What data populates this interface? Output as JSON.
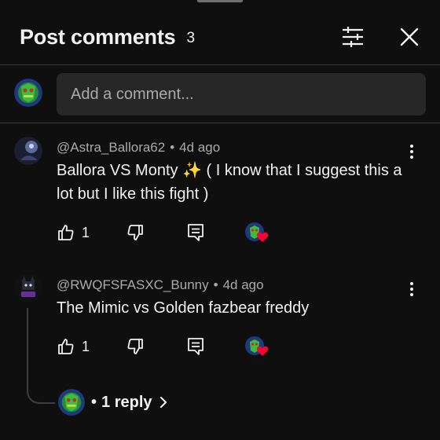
{
  "header": {
    "title": "Post comments",
    "count": "3",
    "filter_icon": "sliders-icon",
    "close_icon": "close-icon"
  },
  "composer": {
    "placeholder": "Add a comment..."
  },
  "comments": [
    {
      "author": "@Astra_Ballora62",
      "time": "4d ago",
      "text": "Ballora VS Monty ✨  ( I know that I suggest this a lot but I like this fight )",
      "likes": "1"
    },
    {
      "author": "@RWQFSFASXC_Bunny",
      "time": "4d ago",
      "text": "The Mimic vs Golden fazbear freddy",
      "likes": "1",
      "replies_label": "1 reply"
    }
  ],
  "separator": "•",
  "colors": {
    "background": "#0f0f0f",
    "input_bg": "#272727",
    "secondary_text": "#aaaaaa",
    "heart": "#ff0033"
  }
}
